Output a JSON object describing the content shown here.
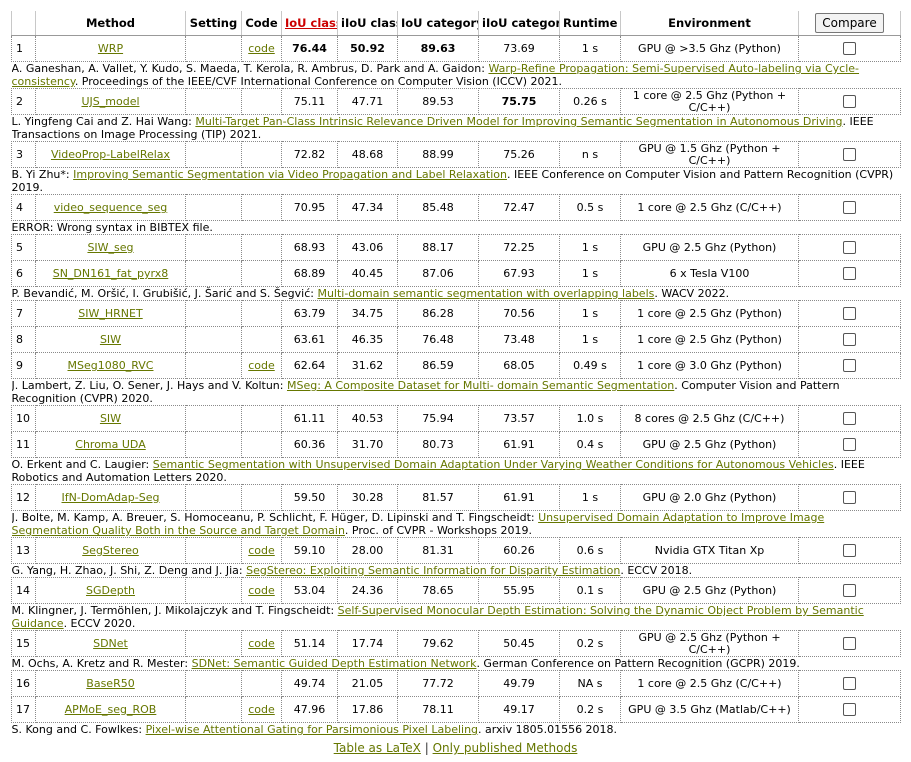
{
  "header": {
    "cols": [
      "Method",
      "Setting",
      "Code",
      "IoU class",
      "iIoU class",
      "IoU category",
      "iIoU category",
      "Runtime",
      "Environment"
    ],
    "compare_label": "Compare"
  },
  "rows": [
    {
      "rank": "1",
      "method": "WRP",
      "code": "code",
      "iou_class": "76.44",
      "iiou_class": "50.92",
      "iou_cat": "89.63",
      "iiou_cat": "73.69",
      "runtime": "1 s",
      "env": "GPU @ >3.5 Ghz (Python)",
      "bold": [
        true,
        true,
        true,
        false
      ],
      "cite": {
        "pre": "A. Ganeshan, A. Vallet, Y. Kudo, S. Maeda, T. Kerola, R. Ambrus, D. Park and A. Gaidon: ",
        "link": "Warp-Refine Propagation: Semi-Supervised Auto-labeling via Cycle- consistency",
        "post": ". Proceedings of the IEEE/CVF International Conference on Computer Vision (ICCV) 2021."
      }
    },
    {
      "rank": "2",
      "method": "UJS_model",
      "code": "",
      "iou_class": "75.11",
      "iiou_class": "47.71",
      "iou_cat": "89.53",
      "iiou_cat": "75.75",
      "runtime": "0.26 s",
      "env": "1 core @ 2.5 Ghz (Python + C/C++)",
      "bold": [
        false,
        false,
        false,
        true
      ],
      "cite": {
        "pre": "L. Yingfeng Cai and Z. Hai Wang: ",
        "link": "Multi-Target Pan-Class Intrinsic Relevance Driven Model for Improving Semantic Segmentation in Autonomous Driving",
        "post": ". IEEE Transactions on Image Processing (TIP) 2021."
      }
    },
    {
      "rank": "3",
      "method": "VideoProp-LabelRelax",
      "code": "",
      "iou_class": "72.82",
      "iiou_class": "48.68",
      "iou_cat": "88.99",
      "iiou_cat": "75.26",
      "runtime": "n s",
      "env": "GPU @ 1.5 Ghz (Python + C/C++)",
      "bold": [
        false,
        false,
        false,
        false
      ],
      "cite": {
        "pre": "B. Yi Zhu*: ",
        "link": "Improving Semantic Segmentation via Video Propagation and Label Relaxation",
        "post": ". IEEE Conference on Computer Vision and Pattern Recognition (CVPR) 2019."
      }
    },
    {
      "rank": "4",
      "method": "video_sequence_seg",
      "code": "",
      "iou_class": "70.95",
      "iiou_class": "47.34",
      "iou_cat": "85.48",
      "iiou_cat": "72.47",
      "runtime": "0.5 s",
      "env": "1 core @ 2.5 Ghz (C/C++)",
      "bold": [
        false,
        false,
        false,
        false
      ],
      "cite": {
        "pre": "ERROR: Wrong syntax in BIBTEX file.",
        "link": "",
        "post": ""
      }
    },
    {
      "rank": "5",
      "method": "SIW_seg",
      "code": "",
      "iou_class": "68.93",
      "iiou_class": "43.06",
      "iou_cat": "88.17",
      "iiou_cat": "72.25",
      "runtime": "1 s",
      "env": "GPU @ 2.5 Ghz (Python)",
      "bold": [
        false,
        false,
        false,
        false
      ],
      "cite": null
    },
    {
      "rank": "6",
      "method": "SN_DN161_fat_pyrx8",
      "code": "",
      "iou_class": "68.89",
      "iiou_class": "40.45",
      "iou_cat": "87.06",
      "iiou_cat": "67.93",
      "runtime": "1 s",
      "env": "6 x Tesla V100",
      "bold": [
        false,
        false,
        false,
        false
      ],
      "cite": {
        "pre": "P. Bevandić, M. Oršić, I. Grubišić, J. Šarić and S. Šegvić: ",
        "link": "Multi-domain semantic segmentation with overlapping labels",
        "post": ". WACV 2022."
      }
    },
    {
      "rank": "7",
      "method": "SIW_HRNET",
      "code": "",
      "iou_class": "63.79",
      "iiou_class": "34.75",
      "iou_cat": "86.28",
      "iiou_cat": "70.56",
      "runtime": "1 s",
      "env": "1 core @ 2.5 Ghz (Python)",
      "bold": [
        false,
        false,
        false,
        false
      ],
      "cite": null
    },
    {
      "rank": "8",
      "method": "SIW",
      "code": "",
      "iou_class": "63.61",
      "iiou_class": "46.35",
      "iou_cat": "76.48",
      "iiou_cat": "73.48",
      "runtime": "1 s",
      "env": "1 core @ 2.5 Ghz (Python)",
      "bold": [
        false,
        false,
        false,
        false
      ],
      "cite": null
    },
    {
      "rank": "9",
      "method": "MSeg1080_RVC",
      "code": "code",
      "iou_class": "62.64",
      "iiou_class": "31.62",
      "iou_cat": "86.59",
      "iiou_cat": "68.05",
      "runtime": "0.49 s",
      "env": "1 core @ 3.0 Ghz (Python)",
      "bold": [
        false,
        false,
        false,
        false
      ],
      "cite": {
        "pre": "J. Lambert, Z. Liu, O. Sener, J. Hays and V. Koltun: ",
        "link": "MSeg: A Composite Dataset for Multi- domain Semantic Segmentation",
        "post": ". Computer Vision and Pattern Recognition (CVPR) 2020."
      }
    },
    {
      "rank": "10",
      "method": "SIW",
      "code": "",
      "iou_class": "61.11",
      "iiou_class": "40.53",
      "iou_cat": "75.94",
      "iiou_cat": "73.57",
      "runtime": "1.0 s",
      "env": "8 cores @ 2.5 Ghz (C/C++)",
      "bold": [
        false,
        false,
        false,
        false
      ],
      "cite": null
    },
    {
      "rank": "11",
      "method": "Chroma UDA",
      "code": "",
      "iou_class": "60.36",
      "iiou_class": "31.70",
      "iou_cat": "80.73",
      "iiou_cat": "61.91",
      "runtime": "0.4 s",
      "env": "GPU @ 2.5 Ghz (Python)",
      "bold": [
        false,
        false,
        false,
        false
      ],
      "cite": {
        "pre": "O. Erkent and C. Laugier: ",
        "link": "Semantic Segmentation with Unsupervised Domain Adaptation Under Varying Weather Conditions for Autonomous Vehicles",
        "post": ". IEEE Robotics and Automation Letters 2020."
      }
    },
    {
      "rank": "12",
      "method": "IfN-DomAdap-Seg",
      "code": "",
      "iou_class": "59.50",
      "iiou_class": "30.28",
      "iou_cat": "81.57",
      "iiou_cat": "61.91",
      "runtime": "1 s",
      "env": "GPU @ 2.0 Ghz (Python)",
      "bold": [
        false,
        false,
        false,
        false
      ],
      "cite": {
        "pre": "J. Bolte, M. Kamp, A. Breuer, S. Homoceanu, P. Schlicht, F. Hüger, D. Lipinski and T. Fingscheidt: ",
        "link": "Unsupervised Domain Adaptation to Improve Image Segmentation Quality Both in the Source and Target Domain",
        "post": ". Proc. of CVPR - Workshops 2019."
      }
    },
    {
      "rank": "13",
      "method": "SegStereo",
      "code": "code",
      "iou_class": "59.10",
      "iiou_class": "28.00",
      "iou_cat": "81.31",
      "iiou_cat": "60.26",
      "runtime": "0.6 s",
      "env": "Nvidia GTX Titan Xp",
      "bold": [
        false,
        false,
        false,
        false
      ],
      "cite": {
        "pre": "G. Yang, H. Zhao, J. Shi, Z. Deng and J. Jia: ",
        "link": "SegStereo: Exploiting Semantic Information for Disparity Estimation",
        "post": ". ECCV 2018."
      }
    },
    {
      "rank": "14",
      "method": "SGDepth",
      "code": "code",
      "iou_class": "53.04",
      "iiou_class": "24.36",
      "iou_cat": "78.65",
      "iiou_cat": "55.95",
      "runtime": "0.1 s",
      "env": "GPU @ 2.5 Ghz (Python)",
      "bold": [
        false,
        false,
        false,
        false
      ],
      "cite": {
        "pre": "M. Klingner, J. Termöhlen, J. Mikolajczyk and T. Fingscheidt: ",
        "link": "Self-Supervised Monocular Depth Estimation: Solving the Dynamic Object Problem by Semantic Guidance",
        "post": ". ECCV 2020."
      }
    },
    {
      "rank": "15",
      "method": "SDNet",
      "code": "code",
      "iou_class": "51.14",
      "iiou_class": "17.74",
      "iou_cat": "79.62",
      "iiou_cat": "50.45",
      "runtime": "0.2 s",
      "env": "GPU @ 2.5 Ghz (Python + C/C++)",
      "bold": [
        false,
        false,
        false,
        false
      ],
      "cite": {
        "pre": "M. Ochs, A. Kretz and R. Mester: ",
        "link": "SDNet: Semantic Guided Depth Estimation Network",
        "post": ". German Conference on Pattern Recognition (GCPR) 2019."
      }
    },
    {
      "rank": "16",
      "method": "BaseR50",
      "code": "",
      "iou_class": "49.74",
      "iiou_class": "21.05",
      "iou_cat": "77.72",
      "iiou_cat": "49.79",
      "runtime": "NA s",
      "env": "1 core @ 2.5 Ghz (C/C++)",
      "bold": [
        false,
        false,
        false,
        false
      ],
      "cite": null
    },
    {
      "rank": "17",
      "method": "APMoE_seg_ROB",
      "code": "code",
      "iou_class": "47.96",
      "iiou_class": "17.86",
      "iou_cat": "78.11",
      "iiou_cat": "49.17",
      "runtime": "0.2 s",
      "env": "GPU @ 3.5 Ghz (Matlab/C++)",
      "bold": [
        false,
        false,
        false,
        false
      ],
      "cite": {
        "pre": "S. Kong and C. Fowlkes: ",
        "link": "Pixel-wise Attentional Gating for Parsimonious Pixel Labeling",
        "post": ". arxiv 1805.01556 2018."
      }
    }
  ],
  "footer": {
    "latex_label": "Table as LaTeX",
    "separator": "|",
    "published_label": "Only published Methods"
  },
  "colors": {
    "link": "#667700",
    "sorted_header": "#cc0000"
  }
}
